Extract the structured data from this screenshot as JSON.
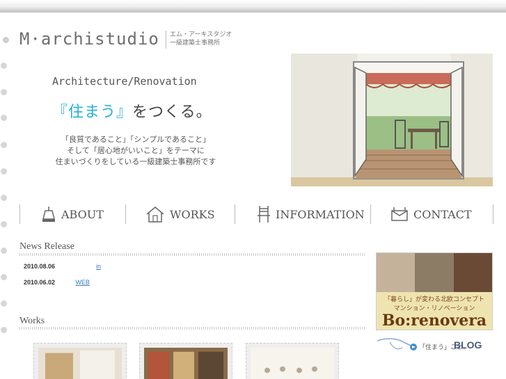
{
  "brand": {
    "logo": "M·archistudio",
    "kana": "エム・アーキスタジオ",
    "type": "一級建築士事務所"
  },
  "hero": {
    "tagline": "Architecture/Renovation",
    "headline_accent": "『住まう』",
    "headline_rest": "をつくる。",
    "intro_1": "「良質であること」「シンプルであること」",
    "intro_2": "そして「居心地がいいこと」をテーマに",
    "intro_3": "住まいづくりをしている一級建築士事務所です"
  },
  "nav": {
    "about": "ABOUT",
    "works": "WORKS",
    "information": "INFORMATION",
    "contact": "CONTACT"
  },
  "news": {
    "title": "News Release",
    "items": [
      {
        "date": "2010.08.06",
        "text": "in"
      },
      {
        "date": "2010.06.02",
        "text": "WEB"
      }
    ]
  },
  "works": {
    "title": "Works"
  },
  "banner": {
    "line1": "「暮らし」が変わる北欧コンセプト",
    "line2": "マンション・リノベーション",
    "brand": "Bo:renovera"
  },
  "blog": {
    "label": "「住まう」こと。",
    "word": "BLOG"
  },
  "colors": {
    "accent": "#24b0d6",
    "text": "#555555",
    "banner_bg": "#efe4b0"
  }
}
